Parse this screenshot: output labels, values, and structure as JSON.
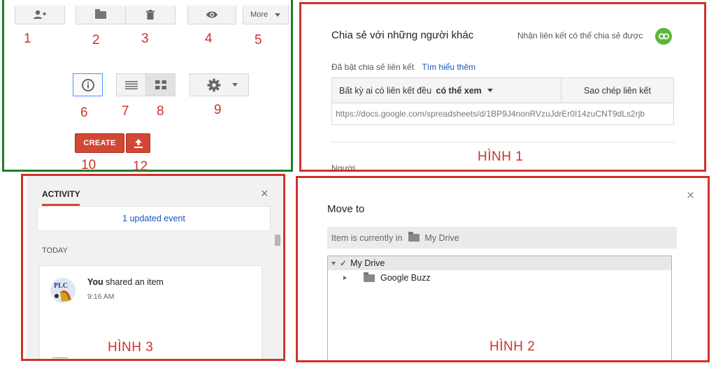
{
  "toolbar": {
    "more_label": "More",
    "create_label": "CREATE",
    "numbers": {
      "n1": "1",
      "n2": "2",
      "n3": "3",
      "n4": "4",
      "n5": "5",
      "n6": "6",
      "n7": "7",
      "n8": "8",
      "n9": "9",
      "n10": "10",
      "n12": "12"
    }
  },
  "share": {
    "title": "Chia sẻ với những người khác",
    "get_link_label": "Nhận liên kết có thể chia sẻ được",
    "link_enabled": "Đã bật chia sẻ liên kết",
    "learn_more": "Tìm hiểu thêm",
    "access_prefix": "Bất kỳ ai có liên kết đều ",
    "access_level": "có thể xem",
    "copy_link": "Sao chép liên kết",
    "url": "https://docs.google.com/spreadsheets/d/1BP9J4nonRVzuJdrEr0I14zuCNT9dLs2rjb",
    "people_label": "Người",
    "figure_label": "HÌNH 1"
  },
  "move": {
    "title": "Move to",
    "current_prefix": "Item is currently in",
    "current_folder": "My Drive",
    "tree_root": "My Drive",
    "tree_child": "Google Buzz",
    "figure_label": "HÌNH 2"
  },
  "activity": {
    "tab_label": "ACTIVITY",
    "updated": "1 updated event",
    "section": "TODAY",
    "actor": "You",
    "action": " shared an item",
    "time": "9:16 AM",
    "avatar_text": "PLC",
    "figure_label": "HÌNH 3"
  },
  "colors": {
    "green_frame": "#1e7e25",
    "red_frame": "#d0312d",
    "create_red": "#d14836",
    "link_blue": "#1a55b8",
    "share_green": "#5fb53a"
  }
}
